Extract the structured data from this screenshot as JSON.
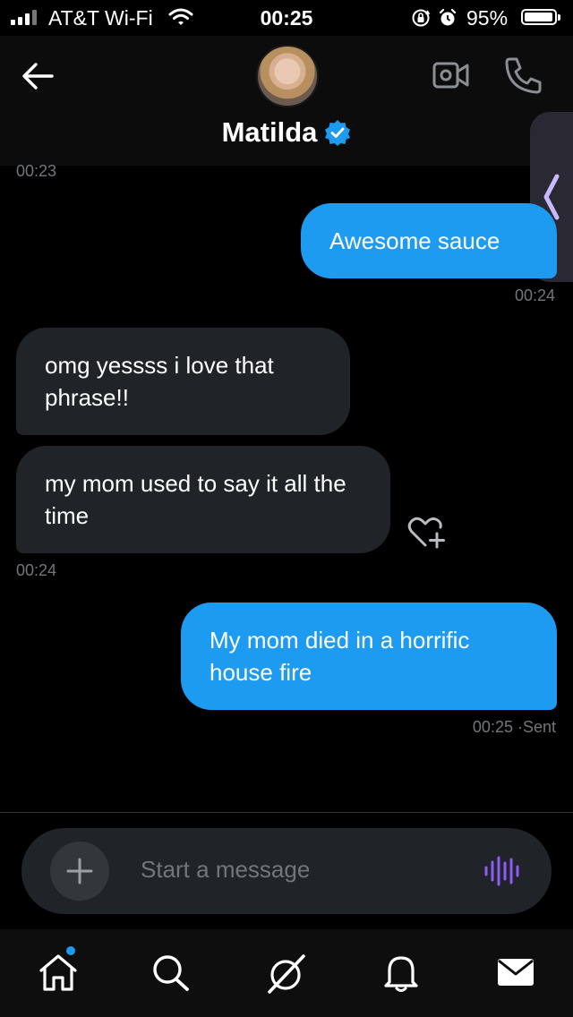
{
  "status_bar": {
    "carrier": "AT&T Wi-Fi",
    "time": "00:25",
    "battery_percent": "95%",
    "battery_level": 0.95,
    "icons": [
      "signal-icon",
      "wifi-icon",
      "orientation-lock-icon",
      "alarm-icon",
      "battery-icon"
    ]
  },
  "header": {
    "contact_name": "Matilda",
    "verified": true,
    "accent_color": "#1d9bf0",
    "icons": [
      "back-arrow-icon",
      "video-call-icon",
      "phone-call-icon",
      "chevron-left-icon"
    ]
  },
  "messages": [
    {
      "type": "timestamp",
      "text": "00:23"
    },
    {
      "direction": "outgoing",
      "text": "Awesome sauce"
    },
    {
      "type": "timestamp",
      "text": "00:24"
    },
    {
      "direction": "incoming",
      "text": "omg yessss i love that phrase!!"
    },
    {
      "direction": "incoming",
      "text": "my mom used to say it all the time"
    },
    {
      "type": "timestamp",
      "text": "00:24"
    },
    {
      "direction": "outgoing",
      "text": "My mom died in a horrific house fire"
    },
    {
      "type": "timestamp",
      "text": "00:25",
      "status": "Sent"
    }
  ],
  "composer": {
    "placeholder": "Start a message",
    "icons": [
      "plus-icon",
      "voice-message-icon"
    ]
  },
  "tab_bar": {
    "tabs": [
      {
        "name": "home",
        "icon": "home-icon",
        "has_badge": true
      },
      {
        "name": "search",
        "icon": "search-icon"
      },
      {
        "name": "grok",
        "icon": "grok-icon"
      },
      {
        "name": "notifications",
        "icon": "bell-icon"
      },
      {
        "name": "messages",
        "icon": "mail-icon",
        "active": true
      }
    ]
  }
}
